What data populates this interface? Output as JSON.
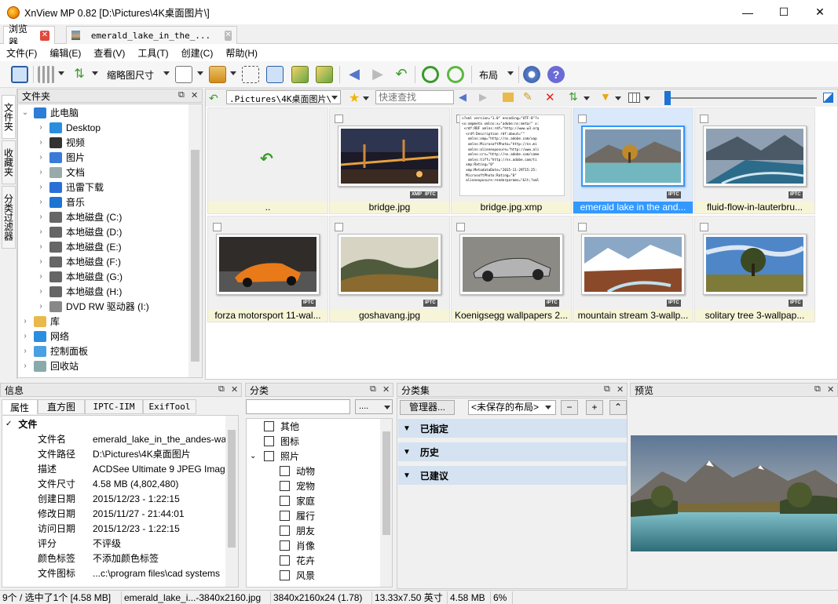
{
  "window": {
    "title": "XnView MP 0.82 [D:\\Pictures\\4K桌面图片\\]",
    "minimize": "—",
    "maximize": "☐",
    "close": "✕"
  },
  "tabs": [
    {
      "label": "浏览器"
    },
    {
      "label": "emerald_lake_in_the_..."
    }
  ],
  "menu": [
    "文件(F)",
    "编辑(E)",
    "查看(V)",
    "工具(T)",
    "创建(C)",
    "帮助(H)"
  ],
  "toolbar": {
    "thumbsize_label": "缩略图尺寸",
    "layout_label": "布局"
  },
  "sidebar_tabs": [
    "文件夹",
    "收藏夹",
    "分类过滤器"
  ],
  "folder_panel": {
    "title": "文件夹"
  },
  "tree": [
    {
      "label": "此电脑",
      "level": 0,
      "expanded": true,
      "icon": "pc-icon"
    },
    {
      "label": "Desktop",
      "level": 1,
      "icon": "desktop-icon"
    },
    {
      "label": "视频",
      "level": 1,
      "icon": "video-folder-icon"
    },
    {
      "label": "图片",
      "level": 1,
      "icon": "pictures-folder-icon"
    },
    {
      "label": "文档",
      "level": 1,
      "icon": "documents-folder-icon"
    },
    {
      "label": "迅雷下载",
      "level": 1,
      "icon": "download-icon"
    },
    {
      "label": "音乐",
      "level": 1,
      "icon": "music-icon"
    },
    {
      "label": "本地磁盘 (C:)",
      "level": 1,
      "icon": "drive-icon"
    },
    {
      "label": "本地磁盘 (D:)",
      "level": 1,
      "icon": "drive-icon"
    },
    {
      "label": "本地磁盘 (E:)",
      "level": 1,
      "icon": "drive-icon"
    },
    {
      "label": "本地磁盘 (F:)",
      "level": 1,
      "icon": "drive-icon"
    },
    {
      "label": "本地磁盘 (G:)",
      "level": 1,
      "icon": "drive-icon"
    },
    {
      "label": "本地磁盘 (H:)",
      "level": 1,
      "icon": "drive-icon"
    },
    {
      "label": "DVD RW 驱动器 (I:)",
      "level": 1,
      "icon": "dvd-icon"
    },
    {
      "label": "库",
      "level": 0,
      "icon": "library-icon"
    },
    {
      "label": "网络",
      "level": 0,
      "icon": "network-icon"
    },
    {
      "label": "控制面板",
      "level": 0,
      "icon": "control-panel-icon"
    },
    {
      "label": "回收站",
      "level": 0,
      "icon": "recycle-bin-icon"
    }
  ],
  "address": {
    "path": ".Pictures\\4K桌面图片\\",
    "search_placeholder": "快速查找"
  },
  "thumbnails": [
    {
      "name": "..",
      "badges": [],
      "kind": "parent",
      "selected": false
    },
    {
      "name": "bridge.jpg",
      "badges": [
        "XMP",
        "IPTC"
      ],
      "kind": "bridge",
      "selected": false
    },
    {
      "name": "bridge.jpg.xmp",
      "badges": [],
      "kind": "xmp",
      "selected": false
    },
    {
      "name": "emerald lake in the and...",
      "badges": [
        "IPTC"
      ],
      "kind": "lake",
      "selected": true
    },
    {
      "name": "fluid-flow-in-lauterbru...",
      "badges": [
        "IPTC"
      ],
      "kind": "river",
      "selected": false
    },
    {
      "name": "forza motorsport 11-wal...",
      "badges": [
        "IPTC"
      ],
      "kind": "car1",
      "selected": false
    },
    {
      "name": "goshavang.jpg",
      "badges": [
        "IPTC"
      ],
      "kind": "fog",
      "selected": false
    },
    {
      "name": "Koenigsegg wallpapers 2...",
      "badges": [
        "IPTC"
      ],
      "kind": "car2",
      "selected": false
    },
    {
      "name": "mountain stream 3-wallp...",
      "badges": [
        "IPTC"
      ],
      "kind": "mountain",
      "selected": false
    },
    {
      "name": "solitary tree 3-wallpap...",
      "badges": [
        "IPTC"
      ],
      "kind": "tree",
      "selected": false
    }
  ],
  "xmp_preview": "<?xml version=\"1.0\" encoding=\"UTF-8\"?>\n<x:xmpmeta xmlns:x=\"adobe:ns:meta/\" x:\n <rdf:RDF xmlns:rdf=\"http://www.w3.org\n  <rdf:Description rdf:about=\"\"\n   xmlns:xmp=\"http://ns.adobe.com/xap\n   xmlns:MicrosoftPhoto=\"http://ns.mi\n   xmlns:alienexposure=\"http://www.ali\n   xmlns:crs=\"http://ns.adobe.com/came\n   xmlns:tiff=\"http://ns.adobe.com/ti\n  xmp:Rating=\"0\"\n  xmp:MetadataDate=\"2015-11-29T15:25:\n  MicrosoftPhoto:Rating=\"0\"\n  alienexposure:renderparams=\"&lt;?xml",
  "info_panel": {
    "title": "信息",
    "tabs": [
      "属性",
      "直方图",
      "IPTC-IIM",
      "ExifTool"
    ],
    "section": "文件",
    "rows": [
      {
        "label": "文件名",
        "value": "emerald_lake_in_the_andes-wa"
      },
      {
        "label": "文件路径",
        "value": "D:\\Pictures\\4K桌面图片"
      },
      {
        "label": "描述",
        "value": "ACDSee Ultimate 9 JPEG Imag"
      },
      {
        "label": "文件尺寸",
        "value": "4.58 MB (4,802,480)"
      },
      {
        "label": "创建日期",
        "value": "2015/12/23 - 1:22:15"
      },
      {
        "label": "修改日期",
        "value": "2015/11/27 - 21:44:01"
      },
      {
        "label": "访问日期",
        "value": "2015/12/23 - 1:22:15"
      },
      {
        "label": "评分",
        "value": "不评级"
      },
      {
        "label": "颜色标签",
        "value": "不添加颜色标签"
      },
      {
        "label": "文件图标",
        "value": "...c:\\program files\\cad systems"
      }
    ]
  },
  "category_panel": {
    "title": "分类",
    "dropdown": "....",
    "items": [
      {
        "label": "其他",
        "level": 0
      },
      {
        "label": "图标",
        "level": 0
      },
      {
        "label": "照片",
        "level": 0,
        "expanded": true
      },
      {
        "label": "动物",
        "level": 1
      },
      {
        "label": "宠物",
        "level": 1
      },
      {
        "label": "家庭",
        "level": 1
      },
      {
        "label": "履行",
        "level": 1
      },
      {
        "label": "朋友",
        "level": 1
      },
      {
        "label": "肖像",
        "level": 1
      },
      {
        "label": "花卉",
        "level": 1
      },
      {
        "label": "风景",
        "level": 1
      }
    ]
  },
  "catset_panel": {
    "title": "分类集",
    "manager_btn": "管理器...",
    "layout_select": "<未保存的布局>",
    "minus": "−",
    "plus": "+",
    "more": "⌃",
    "sections": [
      "已指定",
      "历史",
      "已建议"
    ]
  },
  "preview_panel": {
    "title": "预览"
  },
  "status": [
    "9个 / 选中了1个 [4.58 MB]",
    "emerald_lake_i...-3840x2160.jpg",
    "3840x2160x24 (1.78)",
    "13.33x7.50 英寸",
    "4.58 MB",
    "6%"
  ]
}
